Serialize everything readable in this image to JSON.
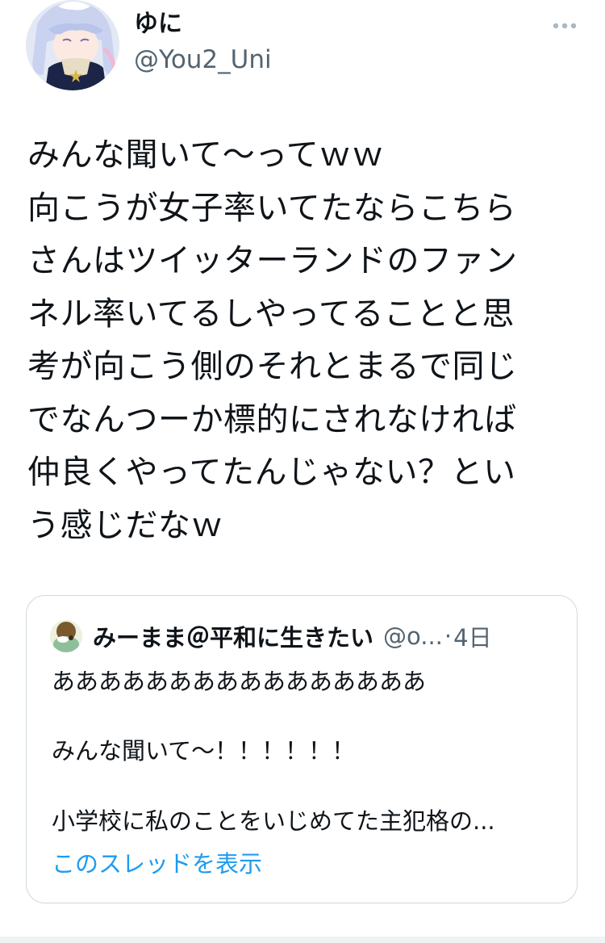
{
  "author": {
    "display_name": "ゆに",
    "handle": "@You2_Uni",
    "avatar_icon": "anime-avatar-icon"
  },
  "more_icon": "more-horizontal-icon",
  "tweet": {
    "lines": [
      "みんな聞いて〜ってｗｗ",
      "向こうが女子率いてたならこちら",
      "さんはツイッターランドのファン",
      "ネル率いてるしやってることと思",
      "考が向こう側のそれとまるで同じ",
      "でなんつーか標的にされなければ",
      "仲良くやってたんじゃない？とい",
      "う感じだなｗ"
    ]
  },
  "quote": {
    "display_name": "みーまま＠平和に生きたい",
    "handle": "@o...",
    "separator": "·",
    "time": "4日",
    "lines": [
      "ああああああああああああああああ",
      "",
      "みんな聞いて〜！！！！！！",
      "",
      "小学校に私のことをいじめてた主犯格の..."
    ],
    "show_thread_label": "このスレッドを表示"
  },
  "colors": {
    "text_primary": "#0f1419",
    "text_secondary": "#536471",
    "link": "#1d9bf0",
    "border": "#cfd9de"
  }
}
